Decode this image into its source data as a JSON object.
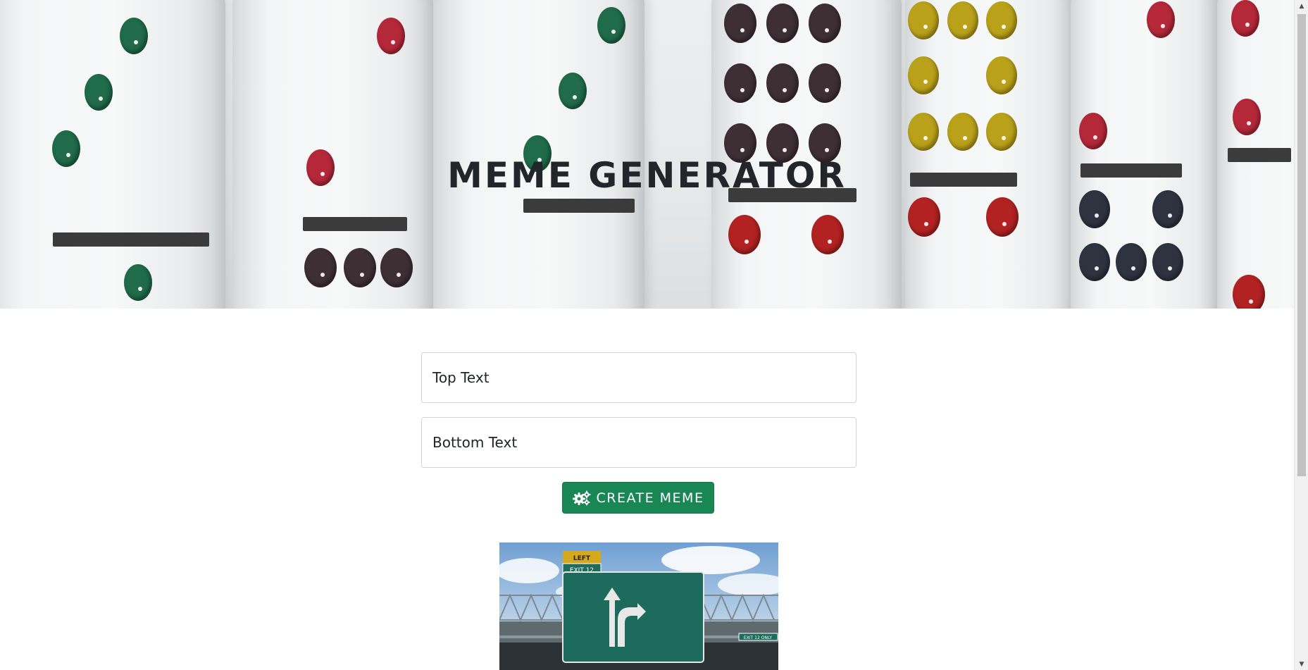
{
  "hero": {
    "title": "MEME GENERATOR",
    "background_image": "dominoes-photo"
  },
  "form": {
    "top_text_placeholder": "Top Text",
    "bottom_text_placeholder": "Bottom Text",
    "submit_label": "CREATE MEME",
    "submit_icon": "gears-icon"
  },
  "preview": {
    "image": "highway-exit-sign-meme",
    "sign_top": "LEFT",
    "sign_exit": "EXIT 12",
    "sign_small": "EXIT 12 ONLY"
  },
  "colors": {
    "button_green": "#198754",
    "title_dark": "#22252a",
    "input_border": "#ced4da"
  }
}
